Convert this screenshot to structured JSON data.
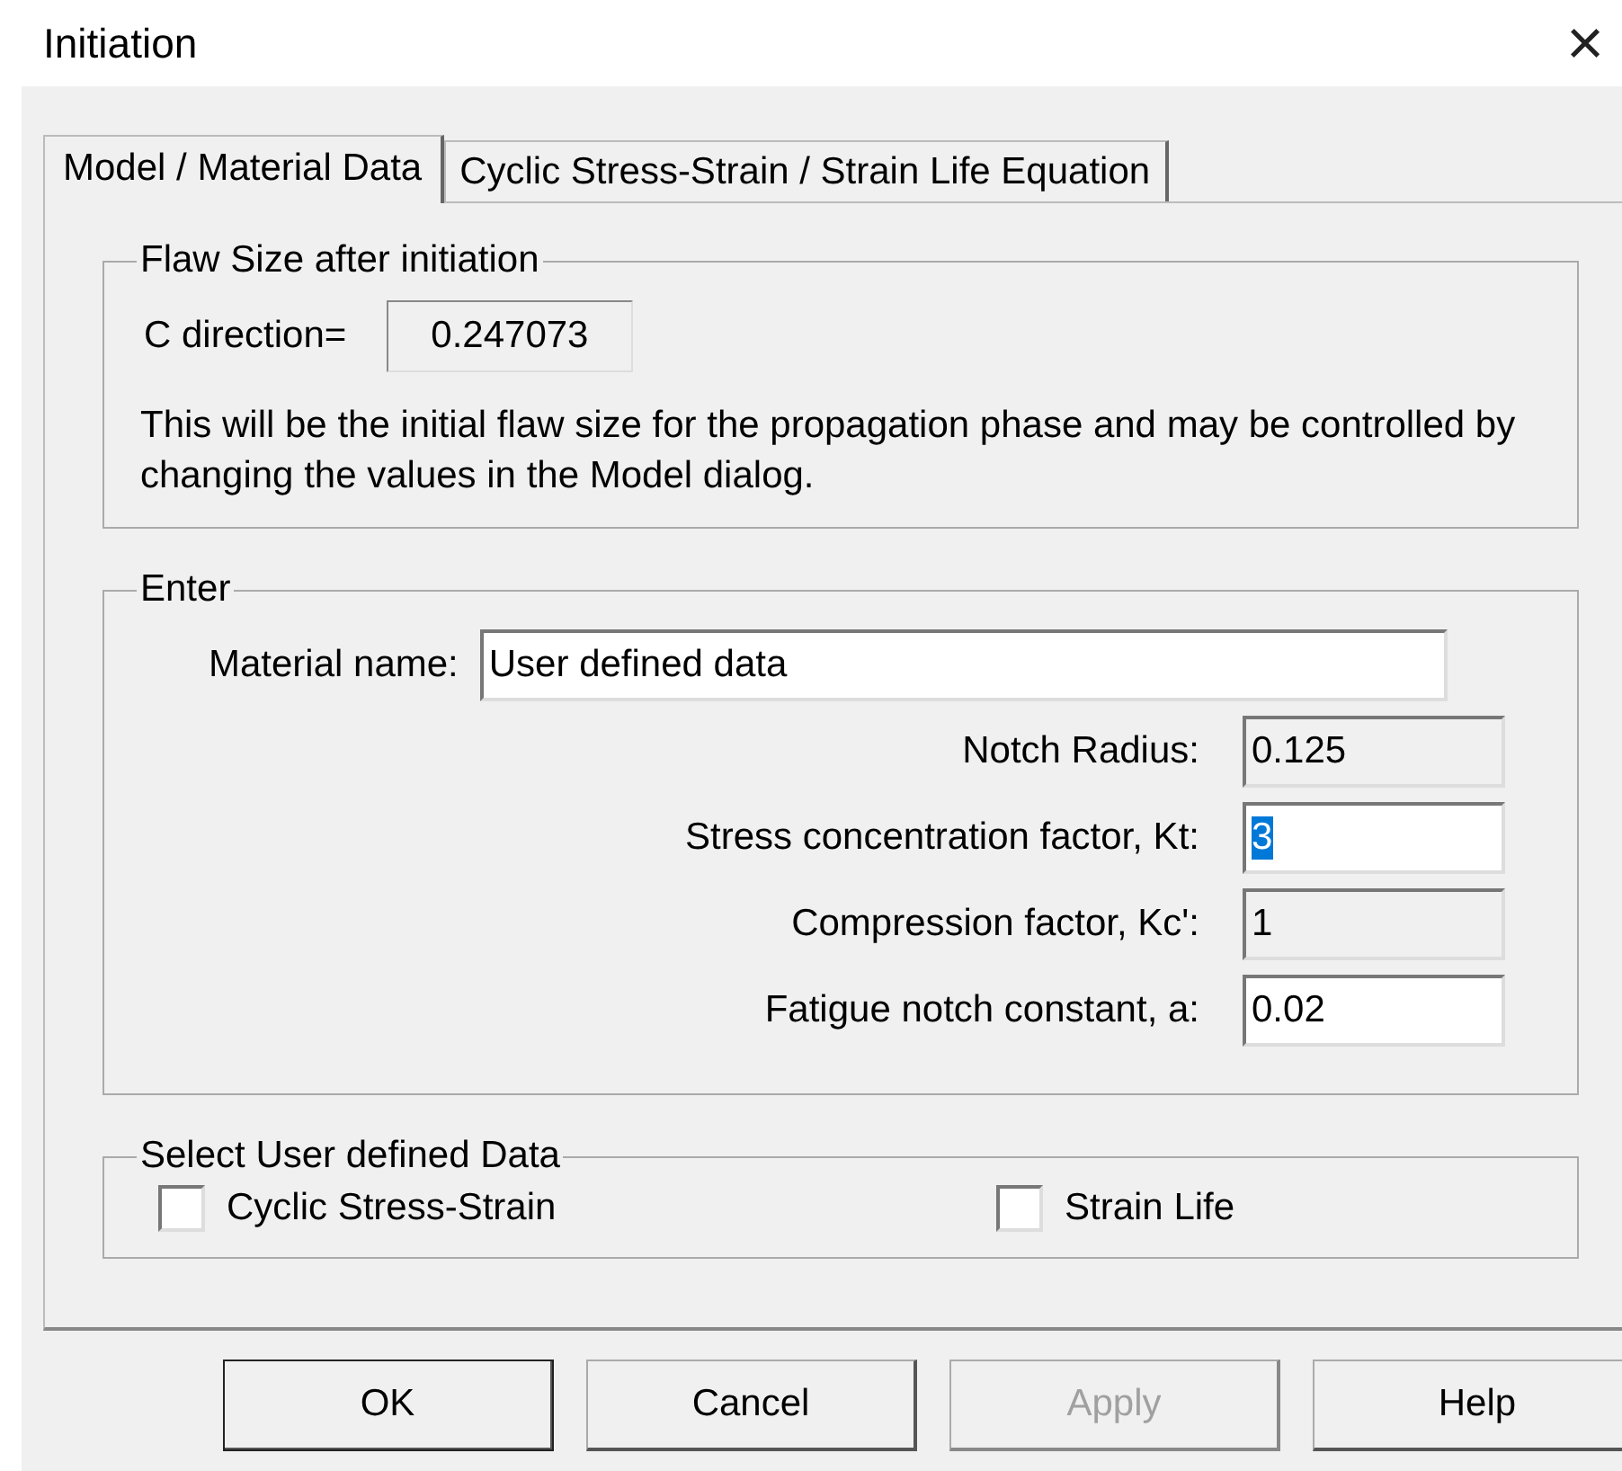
{
  "window": {
    "title": "Initiation",
    "close": "×"
  },
  "tabs": [
    {
      "label": "Model / Material Data",
      "selected": true
    },
    {
      "label": "Cyclic Stress-Strain / Strain Life Equation",
      "selected": false
    }
  ],
  "flaw_group": {
    "title": "Flaw Size after initiation",
    "label": "C direction=",
    "value": "0.247073",
    "note": "This will be the initial flaw size for the propagation phase and may be controlled by changing the values in the Model dialog."
  },
  "enter_group": {
    "title": "Enter",
    "material_label": "Material name:",
    "material_value": "User defined data",
    "fields": [
      {
        "label": "Notch Radius:",
        "value": "0.125",
        "readonly": true,
        "value_selected": false
      },
      {
        "label": "Stress concentration factor, Kt:",
        "value": "3",
        "readonly": false,
        "value_selected": true
      },
      {
        "label": "Compression factor, Kc':",
        "value": "1",
        "readonly": true,
        "value_selected": false
      },
      {
        "label": "Fatigue notch constant, a:",
        "value": "0.02",
        "readonly": false,
        "value_selected": false
      }
    ]
  },
  "select_group": {
    "title": "Select User defined Data",
    "options": [
      {
        "label": "Cyclic Stress-Strain",
        "checked": false
      },
      {
        "label": "Strain Life",
        "checked": false
      }
    ]
  },
  "buttons": [
    {
      "label": "OK",
      "disabled": false,
      "default": true
    },
    {
      "label": "Cancel",
      "disabled": false,
      "default": false
    },
    {
      "label": "Apply",
      "disabled": true,
      "default": false
    },
    {
      "label": "Help",
      "disabled": false,
      "default": false
    }
  ]
}
